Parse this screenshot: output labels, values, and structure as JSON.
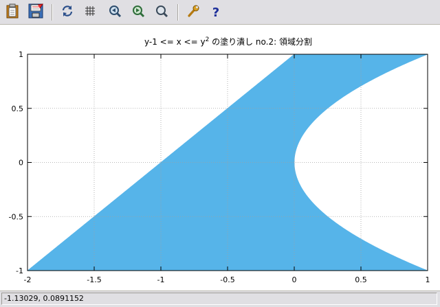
{
  "toolbar": {
    "buttons": [
      {
        "icon": "clipboard-icon",
        "name": "copy-to-clipboard-button"
      },
      {
        "icon": "save-icon",
        "name": "save-button"
      },
      {
        "icon": "replot-icon",
        "name": "replot-button"
      },
      {
        "icon": "grid-icon",
        "name": "grid-button"
      },
      {
        "icon": "zoom-previous-icon",
        "name": "zoom-previous-button"
      },
      {
        "icon": "zoom-next-icon",
        "name": "zoom-next-button"
      },
      {
        "icon": "zoom-unzoom-icon",
        "name": "unzoom-button"
      },
      {
        "icon": "wrench-icon",
        "name": "options-button"
      },
      {
        "icon": "help-icon",
        "name": "help-button"
      }
    ]
  },
  "chart_data": {
    "type": "area",
    "title_pre": "y-1 <= x <= y",
    "title_sup": "2",
    "title_post": " の塗り潰し no.2: 領域分割",
    "xlabel": "",
    "ylabel": "",
    "xlim": [
      -2,
      1
    ],
    "ylim": [
      -1,
      1
    ],
    "x_ticks": [
      "-2",
      "-1.5",
      "-1",
      "-0.5",
      "0",
      "0.5",
      "1"
    ],
    "y_ticks": [
      "1",
      "0.5",
      "0",
      "-0.5",
      "-1"
    ],
    "grid": true,
    "fill_color": "#56b4e9",
    "regions": [
      {
        "lower": "y-1",
        "upper": "0",
        "lower_label": "x = y-1",
        "upper_label": "x = 0"
      },
      {
        "lower": "0",
        "upper": "y^2",
        "lower_label": "x = 0",
        "upper_label": "x = y^2"
      }
    ]
  },
  "status": {
    "coords": "-1.13029, 0.0891152"
  }
}
